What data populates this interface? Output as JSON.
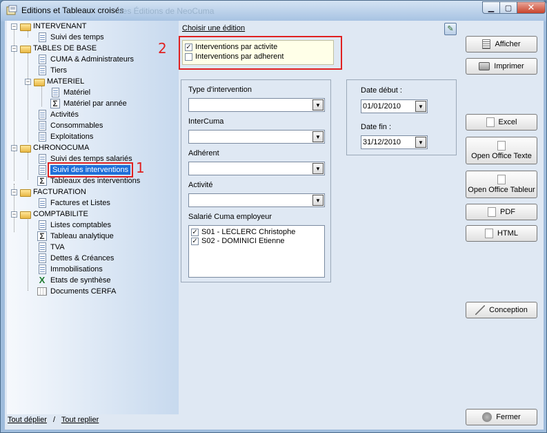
{
  "window": {
    "title": "Editions et Tableaux croisés",
    "ghost_title": "des Éditions de NeoCuma",
    "minimize": "▁",
    "maximize": "▢",
    "close": "✕"
  },
  "tree": {
    "nodes": {
      "intervenant": "INTERVENANT",
      "suivi_temps": "Suivi des temps",
      "tables_base": "TABLES DE BASE",
      "cuma_admin": "CUMA & Administrateurs",
      "tiers": "Tiers",
      "materiel_folder": "MATERIEL",
      "materiel": "Matériel",
      "materiel_annee": "Matériel par année",
      "activites": "Activités",
      "consommables": "Consommables",
      "exploitations": "Exploitations",
      "chronocuma": "CHRONOCUMA",
      "suivi_temps_salaries": "Suivi des temps salariés",
      "suivi_interventions": "Suivi des interventions",
      "tableaux_interventions": "Tableaux des interventions",
      "facturation": "FACTURATION",
      "factures_listes": "Factures et Listes",
      "comptabilite": "COMPTABILITE",
      "listes_comptables": "Listes comptables",
      "tableau_analytique": "Tableau analytique",
      "tva": "TVA",
      "dettes_creances": "Dettes & Créances",
      "immobilisations": "Immobilisations",
      "etats_synthese": "Etats de synthèse",
      "documents_cerfa": "Documents CERFA"
    },
    "footer": {
      "expand_all": "Tout déplier",
      "separator": "/",
      "collapse_all": "Tout replier"
    }
  },
  "annotations": {
    "one": "1",
    "two": "2"
  },
  "edition": {
    "label": "Choisir une édition",
    "options": [
      {
        "label": "Interventions par activite",
        "checked": "✓"
      },
      {
        "label": "Interventions par adherent",
        "checked": ""
      }
    ]
  },
  "filters": {
    "type_label": "Type d'intervention",
    "intercuma_label": "InterCuma",
    "adherent_label": "Adhérent",
    "activite_label": "Activité",
    "salarie_label": "Salarié Cuma employeur",
    "salaries": [
      {
        "label": "S01 - LECLERC Christophe",
        "checked": "✓"
      },
      {
        "label": "S02 - DOMINICI Etienne",
        "checked": "✓"
      }
    ]
  },
  "dates": {
    "start_label": "Date début :",
    "start_value": "01/01/2010",
    "end_label": "Date fin :",
    "end_value": "31/12/2010"
  },
  "buttons": {
    "afficher": "Afficher",
    "imprimer": "Imprimer",
    "excel": "Excel",
    "oo_texte": "Open Office Texte",
    "oo_tableur": "Open Office Tableur",
    "pdf": "PDF",
    "html": "HTML",
    "conception": "Conception",
    "fermer": "Fermer"
  },
  "glyphs": {
    "arrow_down": "▼",
    "expand_minus": "−"
  },
  "colors": {
    "selection": "#1e6fd9",
    "annotation": "#e02020"
  }
}
